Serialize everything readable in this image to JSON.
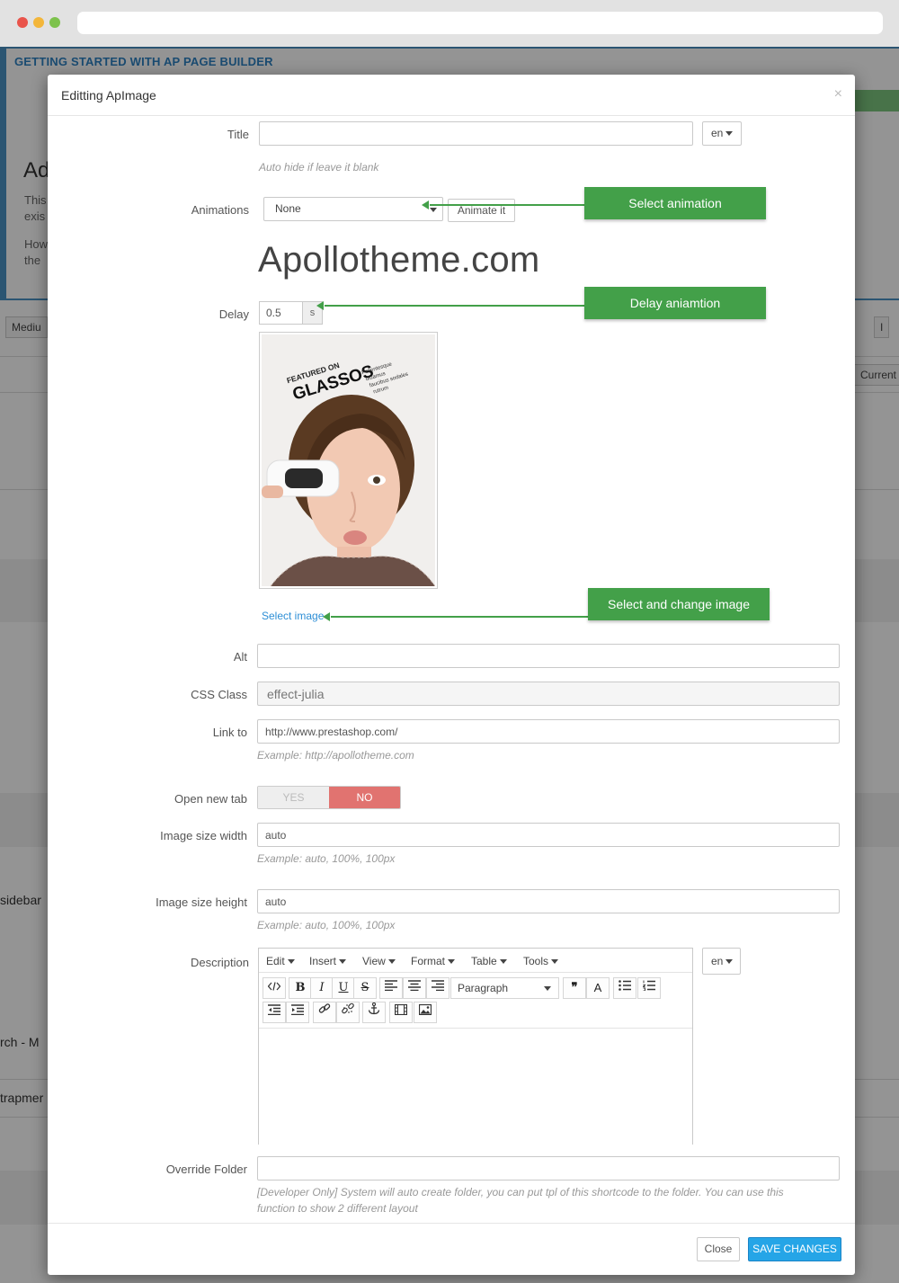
{
  "background": {
    "header": "GETTING STARTED WITH AP PAGE BUILDER",
    "title": "Ad",
    "lines": [
      "This",
      "exis",
      "How",
      "the"
    ],
    "tab_label": "Mediu",
    "right_button": "I",
    "current_label": "Current",
    "sidebar_label": "sidebar",
    "search_label": "rch - M",
    "trap_label": "trapmer"
  },
  "modal": {
    "title": "Editting ApImage",
    "close_symbol": "×",
    "lang": "en",
    "fields": {
      "title": {
        "label": "Title",
        "value": "",
        "help": "Auto hide if leave it blank"
      },
      "animations": {
        "label": "Animations",
        "value": "None",
        "button": "Animate it",
        "demo_text": "Apollotheme.com"
      },
      "delay": {
        "label": "Delay",
        "value": "0.5",
        "unit": "s"
      },
      "image": {
        "select_link": "Select image"
      },
      "alt": {
        "label": "Alt",
        "value": ""
      },
      "css_class": {
        "label": "CSS Class",
        "value": "effect-julia"
      },
      "link_to": {
        "label": "Link to",
        "value": "http://www.prestashop.com/",
        "help": "Example: http://apollotheme.com"
      },
      "open_new_tab": {
        "label": "Open new tab",
        "yes": "YES",
        "no": "NO",
        "selected": "NO"
      },
      "image_width": {
        "label": "Image size width",
        "value": "auto",
        "help": "Example: auto, 100%, 100px"
      },
      "image_height": {
        "label": "Image size height",
        "value": "auto",
        "help": "Example: auto, 100%, 100px"
      },
      "description": {
        "label": "Description",
        "value": ""
      },
      "override_folder": {
        "label": "Override Folder",
        "value": "",
        "help_line1": "[Developer Only] System will auto create folder, you can put tpl of this shortcode to the folder. You can use this",
        "help_line2": "function to show 2 different layout"
      }
    },
    "editor": {
      "menus": [
        "Edit",
        "Insert",
        "View",
        "Format",
        "Table",
        "Tools"
      ],
      "block_format": "Paragraph",
      "bold": "B",
      "italic": "I",
      "underline": "U",
      "strike": "S",
      "quote": "❞",
      "textcolor": "A"
    },
    "image_text": {
      "featured": "FEATURED ON",
      "brand": "GLASSOS",
      "tagline": [
        "Pellentesque",
        "dluamus",
        "faucibus sodales",
        "rutrum"
      ]
    },
    "footer": {
      "close": "Close",
      "save": "SAVE CHANGES"
    }
  },
  "callouts": {
    "animation": "Select animation",
    "delay": "Delay aniamtion",
    "image": "Select and change image"
  },
  "colors": {
    "callout_green": "#43a049",
    "save_blue": "#25a5e7",
    "toggle_no": "#e17370",
    "link_blue": "#2e8fd6"
  }
}
